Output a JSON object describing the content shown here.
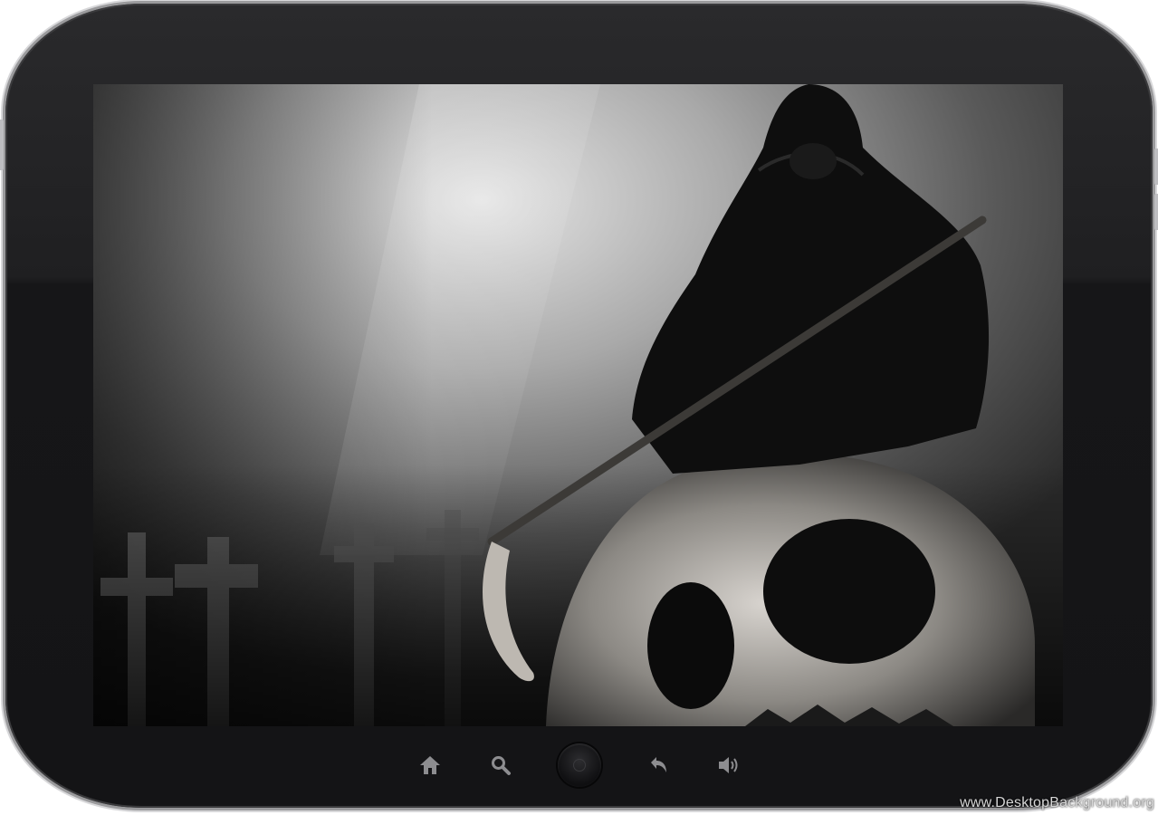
{
  "device": {
    "type": "tablet",
    "frame_color": "#1c1c1e",
    "bezel_trim_color": "#9a9a9c"
  },
  "screen": {
    "wallpaper_description_icon": "grim-reaper-wallpaper",
    "palette": {
      "fog": "#d9d9d9",
      "dark": "#0c0c0c",
      "bone": "#c9c5c0"
    }
  },
  "nav": {
    "items": [
      {
        "icon": "home-icon"
      },
      {
        "icon": "search-icon"
      },
      {
        "icon": "center-home-button"
      },
      {
        "icon": "back-icon"
      },
      {
        "icon": "volume-icon"
      }
    ],
    "icon_color": "#8d8d90"
  },
  "watermark": {
    "text": "www.DesktopBackground.org"
  }
}
